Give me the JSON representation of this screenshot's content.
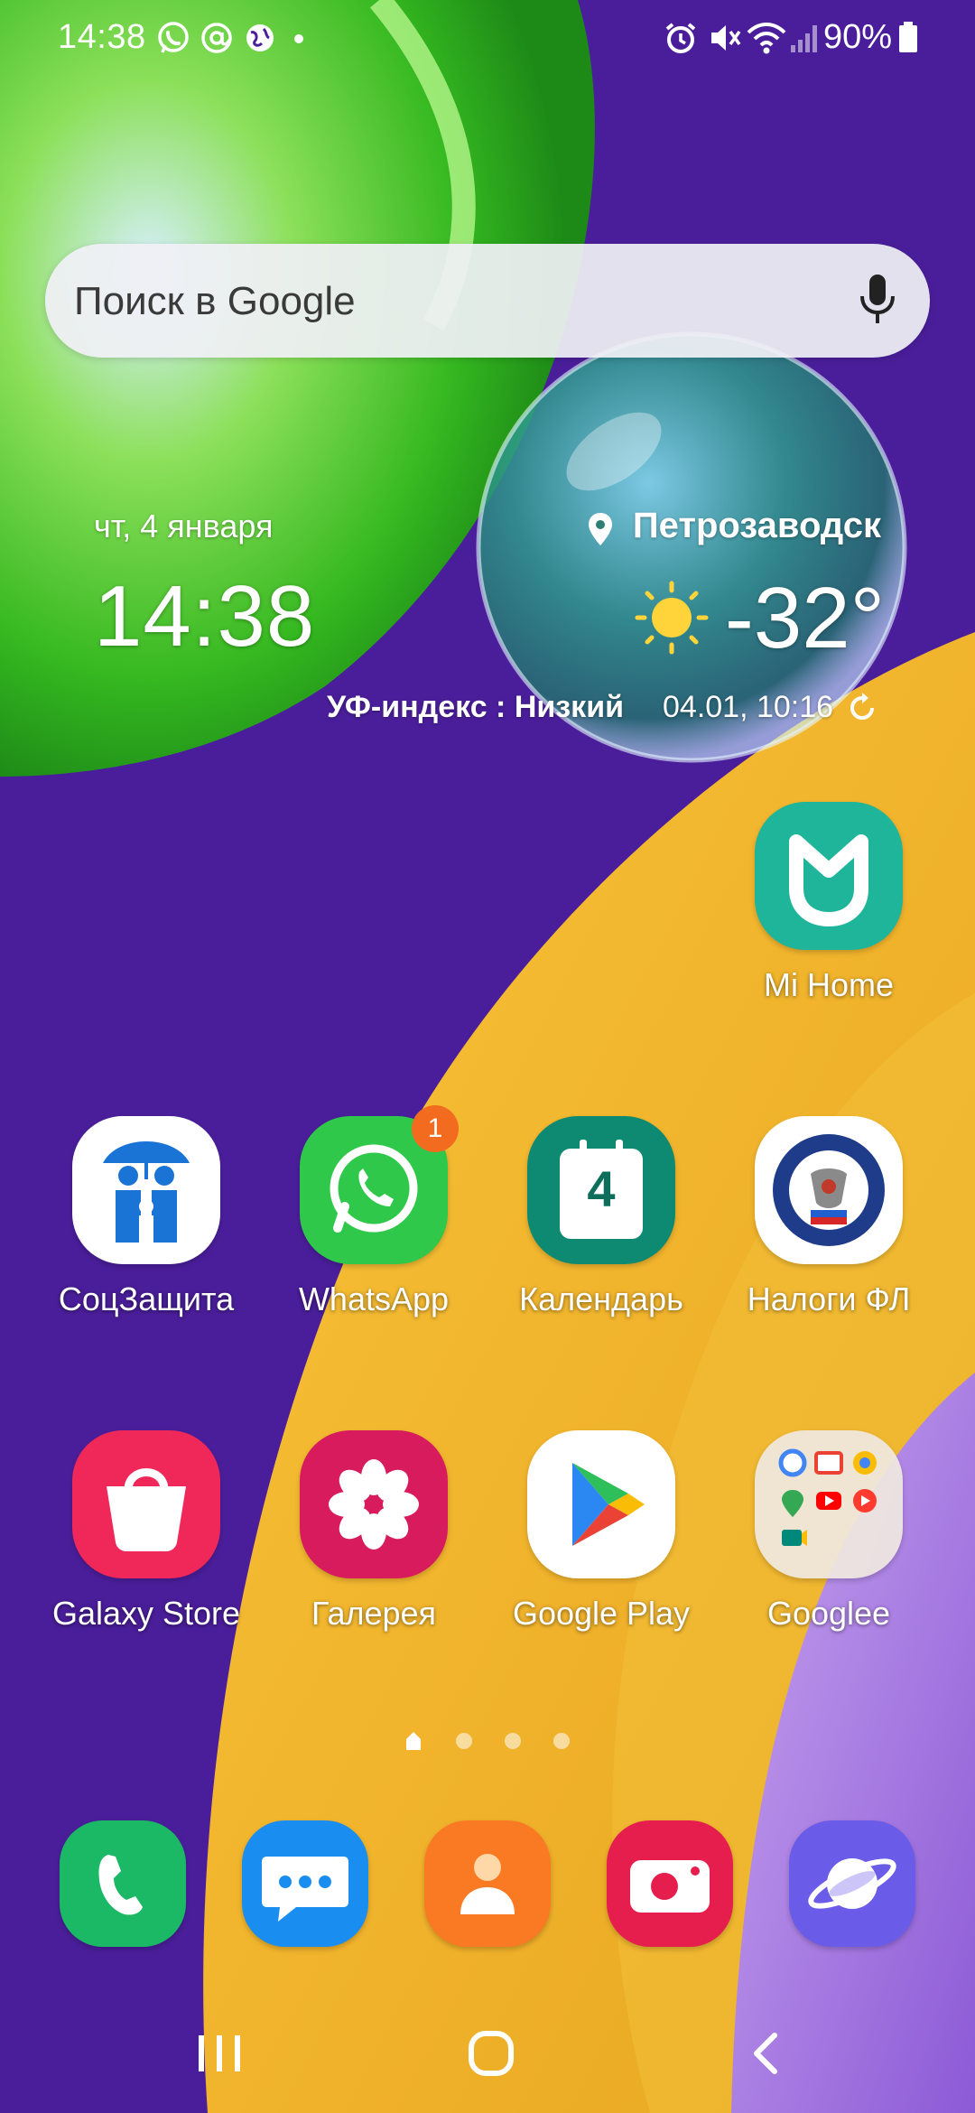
{
  "status_bar": {
    "time": "14:38",
    "battery_percent": "90%",
    "left_icons": [
      "whatsapp-icon",
      "at-icon",
      "globe-icon",
      "dot-icon"
    ],
    "right_icons": [
      "alarm-icon",
      "mute-icon",
      "wifi-icon",
      "signal-icon",
      "battery-icon"
    ]
  },
  "search": {
    "placeholder": "Поиск в Google"
  },
  "clock_widget": {
    "date": "чт, 4 января",
    "time": "14:38"
  },
  "weather_widget": {
    "city": "Петрозаводск",
    "temperature": "-32°",
    "uv_index": "УФ-индекс : Низкий",
    "updated": "04.01, 10:16",
    "icon": "sun-icon"
  },
  "apps": {
    "mi_home": "Mi Home",
    "row1": [
      {
        "label": "СоцЗащита",
        "icon": "family-umbrella-icon"
      },
      {
        "label": "WhatsApp",
        "icon": "whatsapp-icon",
        "badge": "1"
      },
      {
        "label": "Календарь",
        "icon": "calendar-icon",
        "day": "4"
      },
      {
        "label": "Налоги ФЛ",
        "icon": "tax-service-emblem-icon"
      }
    ],
    "row2": [
      {
        "label": "Galaxy Store",
        "icon": "shopping-bag-icon"
      },
      {
        "label": "Галерея",
        "icon": "flower-icon"
      },
      {
        "label": "Google Play",
        "icon": "play-triangle-icon"
      },
      {
        "label": "Googlee",
        "icon": "folder-icon"
      }
    ]
  },
  "page_indicator": {
    "count": 4,
    "current": 1
  },
  "dock": [
    "phone-icon",
    "messages-icon",
    "contacts-icon",
    "camera-icon",
    "internet-icon"
  ],
  "nav_bar": [
    "recents-icon",
    "home-icon",
    "back-icon"
  ],
  "colors": {
    "wallpaper_purple": "#4a1e9a",
    "wallpaper_green": "#4cd12a",
    "wallpaper_yellow": "#f0b62a",
    "badge_orange": "#f26b1f"
  }
}
